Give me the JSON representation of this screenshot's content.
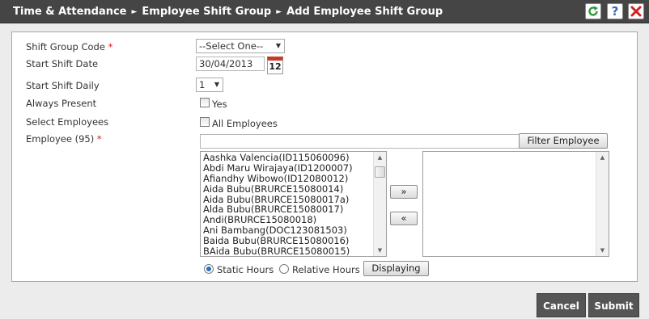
{
  "header": {
    "crumbs": [
      "Time & Attendance",
      "Employee Shift Group",
      "Add Employee Shift Group"
    ],
    "separator": "►",
    "help_label": "?"
  },
  "form": {
    "shift_group_code": {
      "label": "Shift Group Code",
      "required_mark": "*",
      "value": "--Select One--"
    },
    "start_shift_date": {
      "label": "Start Shift Date",
      "value": "30/04/2013",
      "calendar_day": "12"
    },
    "start_shift_daily": {
      "label": "Start Shift Daily",
      "value": "1"
    },
    "always_present": {
      "label": "Always Present",
      "checkbox_label": "Yes",
      "checked": false
    },
    "select_employees": {
      "label": "Select Employees",
      "checkbox_label": "All Employees",
      "checked": false
    },
    "employee": {
      "label": "Employee (95)",
      "required_mark": "*",
      "filter_value": "",
      "filter_button": "Filter Employee",
      "available": [
        "Aashka Valencia(ID115060096)",
        "Abdi Maru Wirajaya(ID1200007)",
        "Afiandhy Wibowo(ID12080012)",
        "Aida Bubu(BRURCE15080014)",
        "Aida Bubu(BRURCE15080017a)",
        "Alda Bubu(BRURCE15080017)",
        "Andi(BRURCE15080018)",
        "Ani Bambang(DOC123081503)",
        "Baida Bubu(BRURCE15080016)",
        "BAida Bubu(BRURCE15080015)"
      ],
      "selected": [],
      "move_right": "»",
      "move_left": "«"
    },
    "hours": {
      "static_label": "Static Hours",
      "relative_label": "Relative Hours",
      "selected": "static",
      "displaying_button": "Displaying"
    }
  },
  "actions": {
    "cancel": "Cancel",
    "submit": "Submit"
  },
  "colors": {
    "header_bg": "#454545",
    "required": "#dd1111",
    "refresh": "#2e9a3a",
    "close": "#d42020"
  }
}
